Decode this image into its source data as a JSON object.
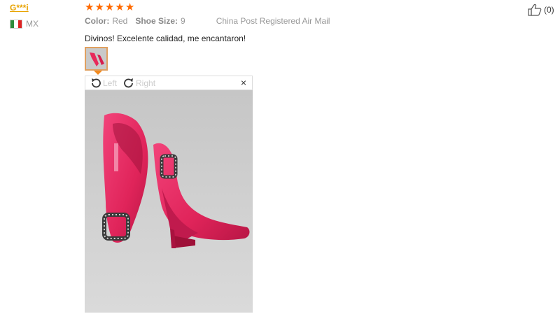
{
  "reviewer": {
    "name": "G***i",
    "country": "MX"
  },
  "review": {
    "stars": 5,
    "color_label": "Color:",
    "color_value": "Red",
    "size_label": "Shoe Size:",
    "size_value": "9",
    "shipping": "China Post Registered Air Mail",
    "text": "Divinos! Excelente calidad, me encantaron!"
  },
  "viewer": {
    "rotate_left": "Left",
    "rotate_right": "Right",
    "close": "×",
    "photo_alt": "Red satin high heel pumps with crystal buckles"
  },
  "helpful": {
    "count": "(0)"
  },
  "colors": {
    "star": "#ff6a00",
    "reviewer": "#e8a300",
    "shoe": "#e8285a",
    "photo_bg": "#d2d2d2"
  }
}
